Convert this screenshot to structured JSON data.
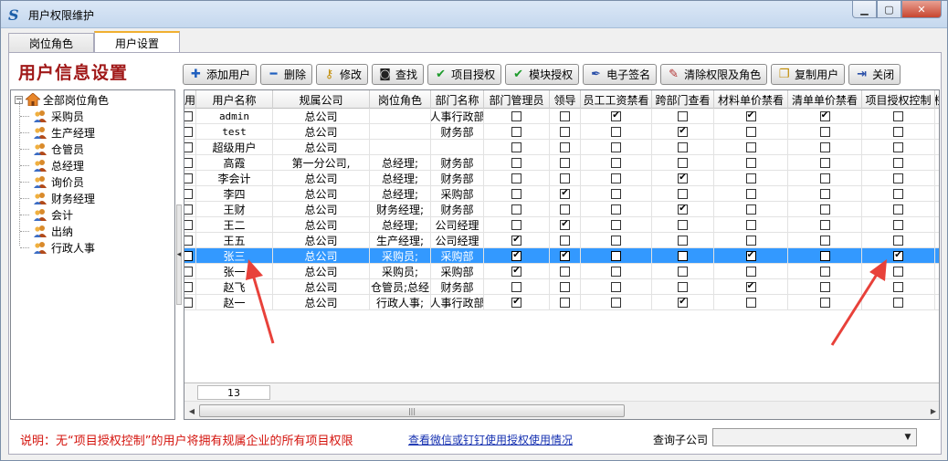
{
  "window": {
    "title": "用户权限维护",
    "app_icon": "S"
  },
  "tabs": [
    {
      "label": "岗位角色",
      "active": false
    },
    {
      "label": "用户设置",
      "active": true
    }
  ],
  "page_title": "用户信息设置",
  "toolbar": [
    {
      "label": "添加用户",
      "icon": "plus-icon",
      "color": "#1f5fbf"
    },
    {
      "label": "删除",
      "icon": "minus-icon",
      "color": "#1f5fbf"
    },
    {
      "label": "修改",
      "icon": "key-icon",
      "color": "#c08a00"
    },
    {
      "label": "查找",
      "icon": "binoculars-icon",
      "color": "#222222"
    },
    {
      "label": "项目授权",
      "icon": "checkmark-icon",
      "color": "#1c9a2a"
    },
    {
      "label": "模块授权",
      "icon": "checkmark-icon",
      "color": "#1c9a2a"
    },
    {
      "label": "电子签名",
      "icon": "pen-icon",
      "color": "#2a4fa8"
    },
    {
      "label": "清除权限及角色",
      "icon": "eraser-icon",
      "color": "#b03030"
    },
    {
      "label": "复制用户",
      "icon": "copy-icon",
      "color": "#c08a00"
    },
    {
      "label": "关闭",
      "icon": "exit-icon",
      "color": "#2a4fa8"
    }
  ],
  "tree": {
    "root": "全部岗位角色",
    "children": [
      "采购员",
      "生产经理",
      "仓管员",
      "总经理",
      "询价员",
      "财务经理",
      "会计",
      "出纳",
      "行政人事"
    ]
  },
  "grid": {
    "columns": [
      "用",
      "用户名称",
      "规属公司",
      "岗位角色",
      "部门名称",
      "部门管理员",
      "领导",
      "员工工资禁看",
      "跨部门查看",
      "材料单价禁看",
      "清单单价禁看",
      "项目授权控制",
      "权"
    ],
    "rows": [
      {
        "name": "admin",
        "company": "总公司",
        "role": "",
        "dept": "人事行政部",
        "flags": [
          0,
          0,
          1,
          0,
          1,
          1,
          0
        ],
        "mono": true
      },
      {
        "name": "test",
        "company": "总公司",
        "role": "",
        "dept": "财务部",
        "flags": [
          0,
          0,
          0,
          1,
          0,
          0,
          0
        ],
        "mono": true
      },
      {
        "name": "超级用户",
        "company": "总公司",
        "role": "",
        "dept": "",
        "flags": [
          0,
          0,
          0,
          0,
          0,
          0,
          0
        ]
      },
      {
        "name": "高霞",
        "company": "第一分公司,",
        "role": "总经理;",
        "dept": "财务部",
        "flags": [
          0,
          0,
          0,
          0,
          0,
          0,
          0
        ]
      },
      {
        "name": "李会计",
        "company": "总公司",
        "role": "总经理;",
        "dept": "财务部",
        "flags": [
          0,
          0,
          0,
          1,
          0,
          0,
          0
        ]
      },
      {
        "name": "李四",
        "company": "总公司",
        "role": "总经理;",
        "dept": "采购部",
        "flags": [
          0,
          1,
          0,
          0,
          0,
          0,
          0
        ]
      },
      {
        "name": "王财",
        "company": "总公司",
        "role": "财务经理;",
        "dept": "财务部",
        "flags": [
          0,
          0,
          0,
          1,
          0,
          0,
          0
        ]
      },
      {
        "name": "王二",
        "company": "总公司",
        "role": "总经理;",
        "dept": "公司经理",
        "flags": [
          0,
          1,
          0,
          0,
          0,
          0,
          0
        ]
      },
      {
        "name": "王五",
        "company": "总公司",
        "role": "生产经理;",
        "dept": "公司经理",
        "flags": [
          1,
          0,
          0,
          0,
          0,
          0,
          0
        ]
      },
      {
        "name": "张三",
        "company": "总公司",
        "role": "采购员;",
        "dept": "采购部",
        "flags": [
          1,
          1,
          0,
          0,
          1,
          0,
          1
        ],
        "selected": true
      },
      {
        "name": "张一",
        "company": "总公司",
        "role": "采购员;",
        "dept": "采购部",
        "flags": [
          1,
          0,
          0,
          0,
          0,
          0,
          0
        ]
      },
      {
        "name": "赵飞",
        "company": "总公司",
        "role": "仓管员;总经",
        "dept": "财务部",
        "flags": [
          0,
          0,
          0,
          0,
          1,
          0,
          0
        ]
      },
      {
        "name": "赵一",
        "company": "总公司",
        "role": "行政人事;",
        "dept": "人事行政部",
        "flags": [
          1,
          0,
          0,
          1,
          0,
          0,
          0
        ]
      }
    ],
    "record_count": "13"
  },
  "bottom": {
    "note": "说明：无“项目授权控制”的用户将拥有规属企业的所有项目权限",
    "link": "查看微信或钉钉使用授权使用情况",
    "subcompany_label": "查询子公司",
    "subcompany_value": ""
  },
  "colors": {
    "title_red": "#a01818",
    "note_red": "#d4140e",
    "selection": "#3399ff",
    "annotation_arrow": "#e8413a"
  }
}
